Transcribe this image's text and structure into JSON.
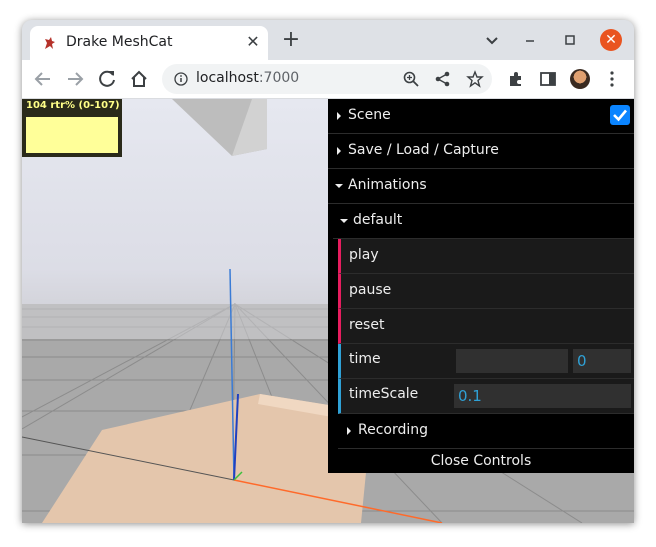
{
  "browser": {
    "tab_title": "Drake MeshCat",
    "new_tab": "+",
    "url_host": "localhost",
    "url_port": ":7000"
  },
  "stats": {
    "text": "104 rtr% (0-107)"
  },
  "controls": {
    "scene": "Scene",
    "scene_checked": true,
    "save_load": "Save / Load / Capture",
    "animations": "Animations",
    "default": "default",
    "play": "play",
    "pause": "pause",
    "reset": "reset",
    "time_label": "time",
    "time_value": "0",
    "timescale_label": "timeScale",
    "timescale_value": "0.1",
    "recording": "Recording",
    "close_controls": "Close Controls"
  },
  "colors": {
    "function_accent": "#e61d5f",
    "number_accent": "#2fa1d6",
    "checkbox": "#0a84ff",
    "close_button": "#e95420"
  }
}
